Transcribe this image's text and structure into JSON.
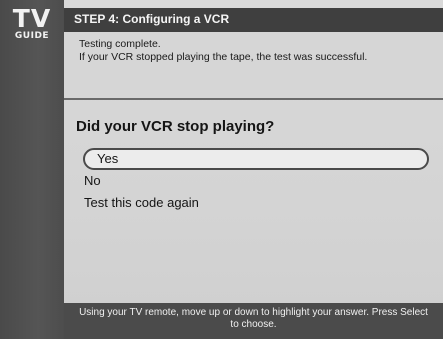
{
  "logo": {
    "tv": "TV",
    "guide": "GUIDE"
  },
  "header": {
    "step_title": "STEP 4: Configuring a VCR"
  },
  "status": {
    "line1": "Testing complete.",
    "line2": "If your VCR stopped playing the tape, the test was successful."
  },
  "question": "Did your VCR stop playing?",
  "options": [
    {
      "label": "Yes",
      "selected": true
    },
    {
      "label": "No",
      "selected": false
    },
    {
      "label": "Test this code again",
      "selected": false
    }
  ],
  "footer": {
    "instructions": "Using your TV remote, move up or down to highlight your answer.  Press Select to choose."
  }
}
